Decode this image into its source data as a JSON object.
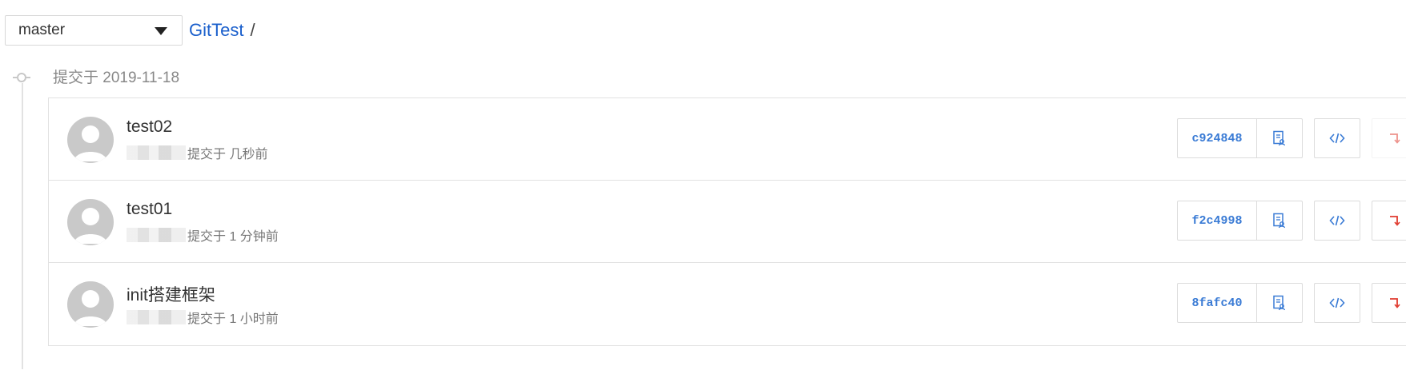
{
  "branch": {
    "selected": "master"
  },
  "breadcrumb": {
    "repo": "GitTest",
    "separator": "/"
  },
  "timeline": {
    "date_label": "提交于 2019-11-18"
  },
  "commits": [
    {
      "title": "test02",
      "meta": "提交于 几秒前",
      "sha": "c924848",
      "revert_enabled": false
    },
    {
      "title": "test01",
      "meta": "提交于 1 分钟前",
      "sha": "f2c4998",
      "revert_enabled": true
    },
    {
      "title": "init搭建框架",
      "meta": "提交于 1 小时前",
      "sha": "8fafc40",
      "revert_enabled": true
    }
  ],
  "colors": {
    "link": "#1a5fcc",
    "sha": "#3a7bd5",
    "revert": "#e03a2e",
    "avatar_bg": "#c9c9c9"
  },
  "icons": {
    "branch_dropdown": "chevron-down-icon",
    "copy": "copy-icon",
    "browse_code": "code-icon",
    "revert": "revert-icon",
    "avatar": "user-avatar-icon"
  }
}
